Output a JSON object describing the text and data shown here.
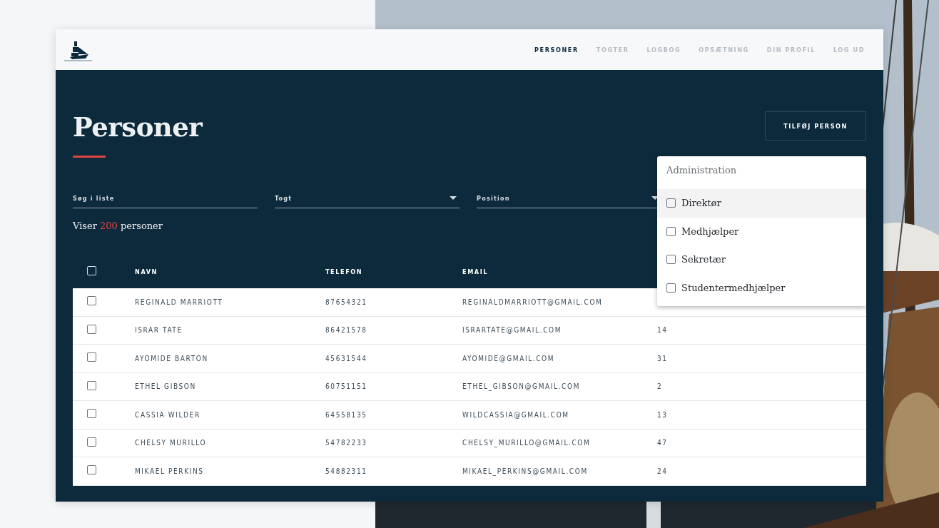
{
  "nav": {
    "items": [
      {
        "label": "PERSONER",
        "selected": true
      },
      {
        "label": "TOGTER",
        "selected": false
      },
      {
        "label": "LOGBOG",
        "selected": false
      },
      {
        "label": "OPSÆTNING",
        "selected": false
      },
      {
        "label": "DIN PROFIL",
        "selected": false
      },
      {
        "label": "LOG UD",
        "selected": false
      }
    ]
  },
  "page": {
    "title": "Personer",
    "add_button": "TILFØJ PERSON"
  },
  "filters": [
    {
      "kind": "text",
      "placeholder": "Søg i liste"
    },
    {
      "kind": "select",
      "placeholder": "Togt"
    },
    {
      "kind": "select",
      "placeholder": "Position"
    }
  ],
  "summary": {
    "prefix": "Viser",
    "count": "200",
    "suffix": "personer"
  },
  "table": {
    "all_checked": false,
    "columns": [
      {
        "label": "NAVN"
      },
      {
        "label": "TELEFON"
      },
      {
        "label": "EMAIL"
      }
    ],
    "rows": [
      {
        "checked": false,
        "name": "REGINALD MARRIOTT",
        "phone": "87654321",
        "email": "REGINALDMARRIOTT@GMAIL.COM"
      },
      {
        "checked": false,
        "name": "ISRAR TATE",
        "phone": "86421578",
        "email": "ISRARTATE@GMAIL.COM",
        "column_4": "14"
      },
      {
        "checked": false,
        "name": "AYOMIDE BARTON",
        "phone": "45631544",
        "email": "AYOMIDE@GMAIL.COM",
        "column_4": "31"
      },
      {
        "checked": false,
        "name": "ETHEL GIBSON",
        "phone": "60751151",
        "email": "ETHEL_GIBSON@GMAIL.COM",
        "column_4": "2"
      },
      {
        "checked": false,
        "name": "CASSIA WILDER",
        "phone": "64558135",
        "email": "WILDCASSIA@GMAIL.COM",
        "column_4": "13"
      },
      {
        "checked": false,
        "name": "CHELSY MURILLO",
        "phone": "54782233",
        "email": "CHELSY_MURILLO@GMAIL.COM",
        "column_4": "47"
      },
      {
        "checked": false,
        "name": "MIKAEL PERKINS",
        "phone": "54882311",
        "email": "MIKAEL_PERKINS@GMAIL.COM",
        "column_4": "24"
      }
    ]
  },
  "dropdown": {
    "group": "Administration",
    "options": [
      {
        "label": "Direktør",
        "checked": false,
        "highlighted": true
      },
      {
        "label": "Medhjælper",
        "checked": false,
        "highlighted": false
      },
      {
        "label": "Sekretær",
        "checked": false,
        "highlighted": false
      },
      {
        "label": "Studentermedhjælper",
        "checked": false,
        "highlighted": false
      }
    ]
  }
}
